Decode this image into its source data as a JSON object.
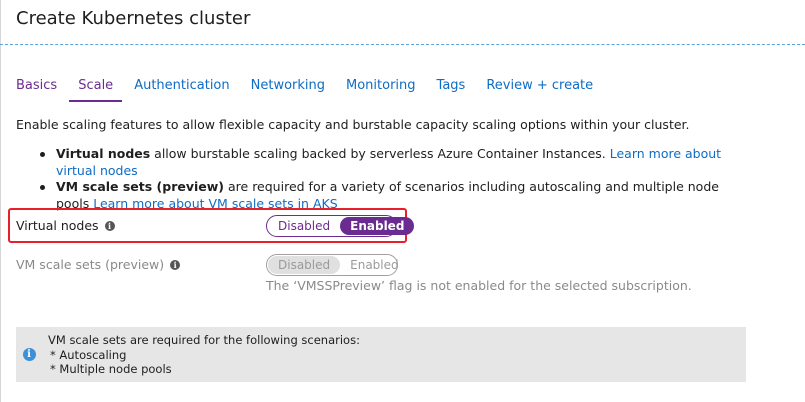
{
  "title": "Create Kubernetes cluster",
  "tabs": [
    {
      "label": "Basics"
    },
    {
      "label": "Scale"
    },
    {
      "label": "Authentication"
    },
    {
      "label": "Networking"
    },
    {
      "label": "Monitoring"
    },
    {
      "label": "Tags"
    },
    {
      "label": "Review + create"
    }
  ],
  "active_tab": "Scale",
  "intro": "Enable scaling features to allow flexible capacity and burstable capacity scaling options within your cluster.",
  "bullets": [
    {
      "bold": "Virtual nodes",
      "text": " allow burstable scaling backed by serverless Azure Container Instances. ",
      "link": "Learn more about virtual nodes"
    },
    {
      "bold": "VM scale sets (preview)",
      "text": " are required for a variety of scenarios including autoscaling and multiple node pools ",
      "link": "Learn more about VM scale sets in AKS"
    }
  ],
  "virtual_nodes": {
    "label": "Virtual nodes",
    "off_label": "Disabled",
    "on_label": "Enabled",
    "selected": "Enabled"
  },
  "vm_scale_sets": {
    "label": "VM scale sets (preview)",
    "off_label": "Disabled",
    "on_label": "Enabled",
    "selected": "Disabled",
    "note": "The ‘VMSSPreview’ flag is not enabled for the selected subscription."
  },
  "info_box": {
    "heading": "VM scale sets are required for the following scenarios:",
    "items": [
      "* Autoscaling",
      "* Multiple node pools"
    ]
  },
  "colors": {
    "accent": "#6b2c91",
    "link": "#0e6cc4",
    "highlight": "#e8202a",
    "info_icon": "#3c8fd9"
  }
}
